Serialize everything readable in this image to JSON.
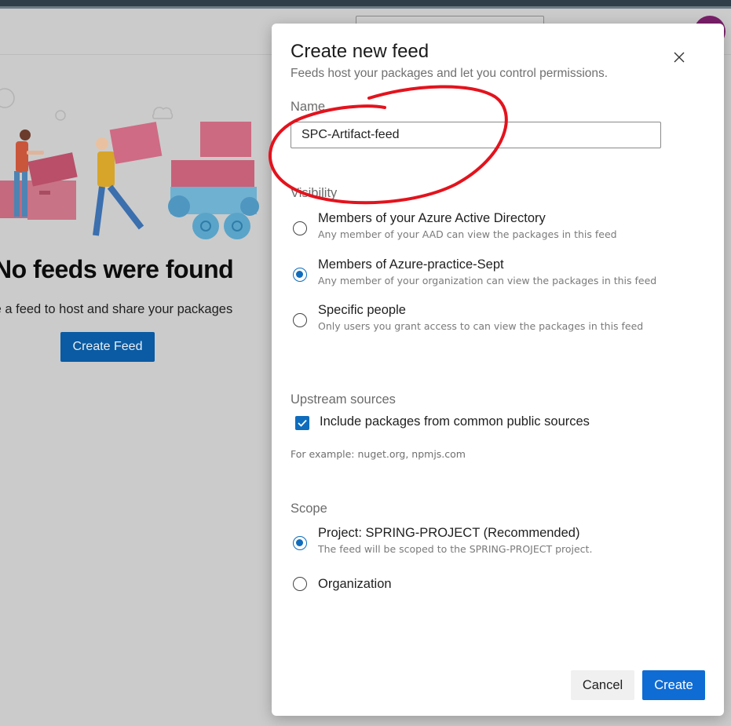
{
  "background": {
    "empty_state": {
      "title": "No feeds were found",
      "subtitle": "te a feed to host and share your packages",
      "button_label": "Create Feed"
    }
  },
  "dialog": {
    "title": "Create new feed",
    "subtitle": "Feeds host your packages and let you control permissions.",
    "name": {
      "label": "Name",
      "value": "SPC-Artifact-feed"
    },
    "visibility": {
      "label": "Visibility",
      "options": [
        {
          "label": "Members of your Azure Active Directory",
          "description": "Any member of your AAD can view the packages in this feed",
          "selected": false
        },
        {
          "label": "Members of Azure-practice-Sept",
          "description": "Any member of your organization can view the packages in this feed",
          "selected": true
        },
        {
          "label": "Specific people",
          "description": "Only users you grant access to can view the packages in this feed",
          "selected": false
        }
      ]
    },
    "upstream": {
      "label": "Upstream sources",
      "checkbox_label": "Include packages from common public sources",
      "checked": true,
      "example": "For example: nuget.org, npmjs.com"
    },
    "scope": {
      "label": "Scope",
      "options": [
        {
          "label": "Project: SPRING-PROJECT (Recommended)",
          "description": "The feed will be scoped to the SPRING-PROJECT project.",
          "selected": true
        },
        {
          "label": "Organization",
          "description": "",
          "selected": false
        }
      ]
    },
    "buttons": {
      "cancel": "Cancel",
      "create": "Create"
    }
  },
  "colors": {
    "accent": "#0f6cbd",
    "annotation": "#e3131d",
    "overlay": "#cbcbcb"
  },
  "icons": {
    "close": "close-icon",
    "check": "checkmark-icon"
  }
}
